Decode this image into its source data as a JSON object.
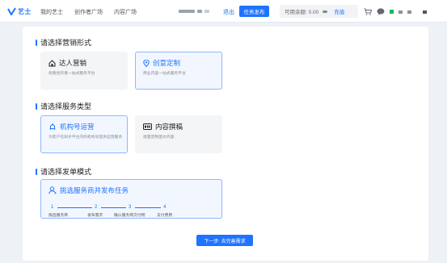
{
  "topbar": {
    "logo_text": "艺士",
    "nav": [
      "我的艺士",
      "创作者广场",
      "内容广场"
    ],
    "exit_label": "退出",
    "publish_label": "任务发布",
    "balance_label": "可用余额: 0.00",
    "recharge_label": "充值"
  },
  "sections": {
    "marketing": {
      "title": "请选择营销形式",
      "options": [
        {
          "title": "达人营销",
          "desc": "优质创作者一站式服务平台",
          "selected": false
        },
        {
          "title": "创意定制",
          "desc": "商业内容一站式服务平台",
          "selected": true
        }
      ]
    },
    "service": {
      "title": "请选择服务类型",
      "options": [
        {
          "title": "机构号运营",
          "desc": "为客户在知乎平台内的机构号提供运营服务",
          "selected": true
        },
        {
          "title": "内容撰稿",
          "desc": "批量定制图文内容",
          "selected": false
        }
      ]
    },
    "order": {
      "title": "请选择发单模式",
      "option": {
        "title": "挑选服务商并发布任务",
        "steps": [
          {
            "num": "1",
            "label": "挑选服务商"
          },
          {
            "num": "2",
            "label": "发布需求"
          },
          {
            "num": "3",
            "label": "确认服务商交付物"
          },
          {
            "num": "4",
            "label": "支付费用"
          }
        ]
      }
    }
  },
  "next_button_label": "下一步: 去完善需求",
  "colors": {
    "accent": "#1e73ff",
    "selected_bg": "#f2f7ff",
    "plain_bg": "#f4f5f7"
  }
}
